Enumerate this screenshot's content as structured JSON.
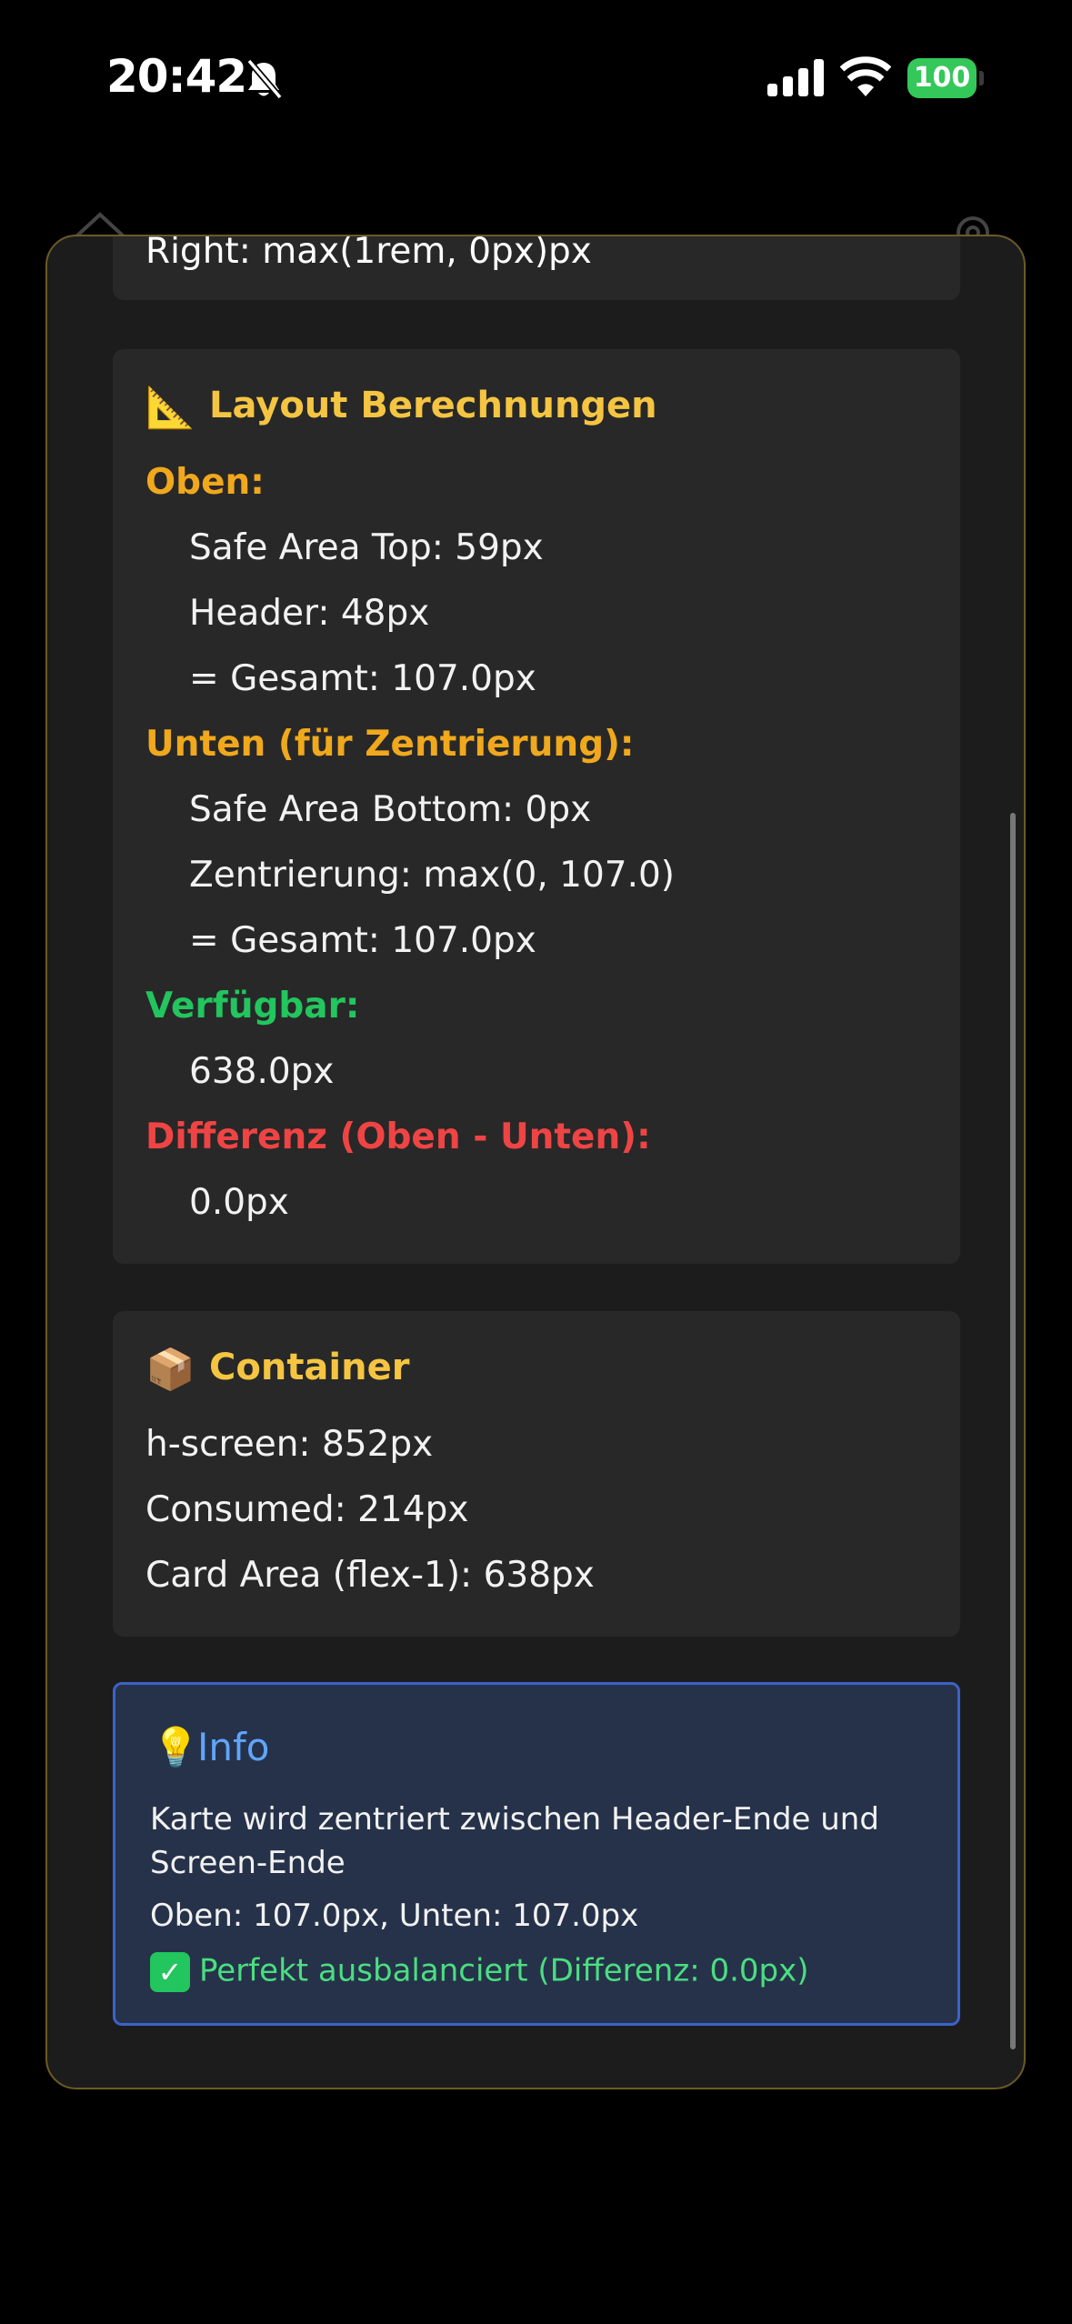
{
  "status_bar": {
    "time": "20:42",
    "battery": "100"
  },
  "top_card": {
    "line": "Right: max(1rem, 0px)px"
  },
  "layout_card": {
    "emoji": "📐",
    "title": "Layout Berechnungen",
    "oben_label": "Oben:",
    "oben_lines": [
      "Safe Area Top: 59px",
      "Header: 48px",
      "= Gesamt: 107.0px"
    ],
    "unten_label": "Unten (für Zentrierung):",
    "unten_lines": [
      "Safe Area Bottom: 0px",
      "Zentrierung: max(0, 107.0)",
      "= Gesamt: 107.0px"
    ],
    "verfuegbar_label": "Verfügbar:",
    "verfuegbar_value": "638.0px",
    "differenz_label": "Differenz (Oben - Unten):",
    "differenz_value": "0.0px"
  },
  "container_card": {
    "emoji": "📦",
    "title": "Container",
    "lines": [
      "h-screen: 852px",
      "Consumed: 214px",
      "Card Area (flex-1): 638px"
    ]
  },
  "info_box": {
    "emoji": "💡",
    "title": "Info",
    "text": "Karte wird zentriert zwischen Header-Ende und Screen-Ende",
    "values": "Oben: 107.0px, Unten: 107.0px",
    "check_glyph": "✓",
    "status": "Perfekt ausbalanciert (Differenz: 0.0px)"
  }
}
